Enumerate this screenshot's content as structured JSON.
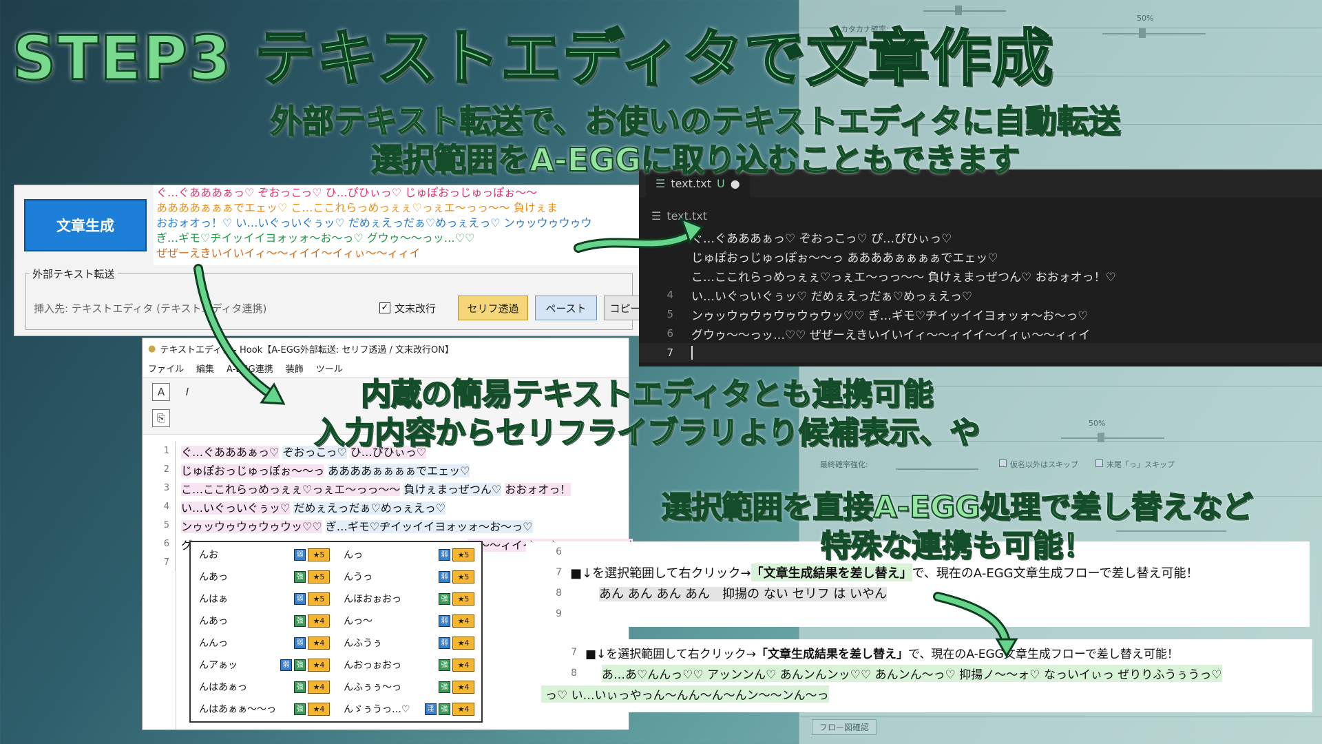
{
  "title": {
    "main": "STEP3 テキストエディタで文章作成"
  },
  "subtitles": {
    "s1_line1": "外部テキスト転送で、お使いのテキストエディタに自動転送",
    "s1_line2": "選択範囲をA-EGGに取り込むこともできます",
    "s2_line1": "内蔵の簡易テキストエディタとも連携可能",
    "s2_line2": "入力内容からセリフライブラリより候補表示、や",
    "s3_line1": "選択範囲を直接A-EGG処理で差し替えなど",
    "s3_line2": "特殊な連携も可能！"
  },
  "generator": {
    "button_label": "文章生成",
    "output_lines": [
      "ぐ…ぐあああぁっ♡ ぞおっこっ♡ ひ…ぴひぃっ♡ じゅぽおっじゅっぽぉ～～",
      "ああああぁぁぁでエェッ♡ こ…ここれらっめっぇぇ♡っぇエ～っっ～～ 負けぇま",
      "おおォオっ！♡ い…いぐっいぐぅッ♡ だめぇえっだぁ♡めっぇえっ♡ ンゥッウゥウゥウ",
      "ぎ…ギモ♡ヂイッイイヨォッォ～お～っ♡ グウゥ～～っッ…♡♡",
      "ぜぜーえきいイいイィ～～ィイイ～イィぃ～～ィィイ"
    ],
    "group_title": "外部テキスト転送",
    "insert_target": "挿入先: テキストエディタ (テキストエディタ連携)",
    "checkbox_label": "文末改行",
    "checkbox_mark": "✓",
    "btn_serif": "セリフ透過",
    "btn_paste": "ペースト",
    "btn_copy": "コピー"
  },
  "vscode": {
    "tab_name": "text.txt",
    "tab_status": "U",
    "breadcrumb": "text.txt",
    "lines": [
      {
        "n": "",
        "t": "ぐ…ぐあああぁっ♡ ぞおっこっ♡ ぴ…ぴひぃっ♡"
      },
      {
        "n": "",
        "t": "じゅぽおっじゅっぽぉ～～っ ああああぁぁぁぁでエェッ♡"
      },
      {
        "n": "",
        "t": "こ…ここれらっめっぇぇ♡っぇエ～っっ～～ 負けぇまっぜつん♡ おおォオっ！♡"
      },
      {
        "n": "4",
        "t": "い…いぐっいぐぅッ♡ だめぇえっだぁ♡めっぇえっ♡"
      },
      {
        "n": "5",
        "t": "ンゥッウゥウゥウゥウゥウッ♡♡ ぎ…ギモ♡ヂイッイイヨォッォ～お～っ♡"
      },
      {
        "n": "6",
        "t": "グウゥ～～っッ…♡♡ ぜぜーえきいイいイィ～～ィイイ～イィぃ～～ィィイ"
      },
      {
        "n": "7",
        "t": ""
      }
    ]
  },
  "editor": {
    "title": "テキストエディタ - Hook【A-EGG外部転送: セリフ透過 / 文末改行ON】",
    "menu": [
      "ファイル",
      "編集",
      "A-EGG連携",
      "装飾",
      "ツール"
    ],
    "lines": [
      {
        "n": "1",
        "a": "ぐ…ぐあああぁっ♡",
        "b": "ぞおっこっ♡",
        "c": "ひ…ぴひぃっ♡"
      },
      {
        "n": "2",
        "a": "じゅぽおっじゅっぽぉ～～っ",
        "b": "ああああぁぁぁぁでエェッ♡",
        "c": ""
      },
      {
        "n": "3",
        "a": "こ…ここれらっめっぇぇ♡っぇエ～っっ～～",
        "b": "負けぇまっぜつん♡",
        "c": "おおォオっ！"
      },
      {
        "n": "4",
        "a": "い…いぐっいぐぅッ♡",
        "b": "だめぇえっだぁ♡めっぇえっ♡",
        "c": ""
      },
      {
        "n": "5",
        "a": "ンゥッウゥウゥウゥウッ♡♡",
        "b": "ぎ…ギモ♡ヂイッイイヨォッォ～お～っ♡",
        "c": ""
      },
      {
        "n": "6",
        "a": "グ",
        "b": "ィ～～ィイイ～イィぃ～～ィィイ",
        "c": ""
      },
      {
        "n": "7",
        "a": "",
        "b": "",
        "c": ""
      }
    ]
  },
  "autocomplete": {
    "rows": [
      {
        "l": "んお",
        "lb": [
          "弱"
        ],
        "ls": "★5",
        "r": "んっ",
        "rb": [
          "弱"
        ],
        "rs": "★5"
      },
      {
        "l": "んあっ",
        "lb": [
          "強"
        ],
        "ls": "★5",
        "r": "んうっ",
        "rb": [
          "弱"
        ],
        "rs": "★5"
      },
      {
        "l": "んはぁ",
        "lb": [
          "弱"
        ],
        "ls": "★5",
        "r": "んほおぉおっ",
        "rb": [
          "強"
        ],
        "rs": "★5"
      },
      {
        "l": "んあっ",
        "lb": [
          "強"
        ],
        "ls": "★4",
        "r": "んっ～",
        "rb": [
          "弱"
        ],
        "rs": "★4"
      },
      {
        "l": "んんっ",
        "lb": [
          "弱"
        ],
        "ls": "★4",
        "r": "んふうぅ",
        "rb": [
          "弱"
        ],
        "rs": "★4"
      },
      {
        "l": "んアぁッ",
        "lb": [
          "弱",
          "強"
        ],
        "ls": "★4",
        "r": "んおっぉおっ",
        "rb": [
          "強"
        ],
        "rs": "★4"
      },
      {
        "l": "んはあぁっ",
        "lb": [
          "強"
        ],
        "ls": "★4",
        "r": "んふぅぅ～っ",
        "rb": [
          "強"
        ],
        "rs": "★4"
      },
      {
        "l": "んはあぁぁ～～っ",
        "lb": [
          "強"
        ],
        "ls": "★4",
        "r": "んゞぅうっ…♡",
        "rb": [
          "淫",
          "強"
        ],
        "rs": "★4"
      }
    ]
  },
  "example1": {
    "lines": [
      {
        "n": "6",
        "t": ""
      },
      {
        "n": "7",
        "pre": "■↓を選択範囲して右クリック→",
        "bold": "「文章生成結果を差し替え」",
        "post": "で、現在のA-EGG文章生成フローで差し替え可能！"
      },
      {
        "n": "8",
        "t": "あん あん あん あん　抑揚の ない セリフ は いやん"
      },
      {
        "n": "9",
        "t": ""
      }
    ]
  },
  "example2": {
    "lines": [
      {
        "n": "7",
        "pre": "■↓を選択範囲して右クリック→",
        "bold": "「文章生成結果を差し替え」",
        "post": "で、現在のA-EGG文章生成フローで差し替え可能！"
      },
      {
        "n": "8",
        "t": "あ…あ♡んんっ♡♡ アッンンん♡ あんンんンッ♡♡ あんンん～っ♡ 抑揚ノ～～ォ♡ なっいイぃっ ぜりりふうぅうっ♡"
      },
      {
        "n": "",
        "t": "っ♡ い…いぃっやっん～んん～ん～んン～～ンん～っ"
      }
    ]
  },
  "background_panel": {
    "labels": [
      "カタカナ確率:",
      "50%",
      "50%",
      "最終確率強化:",
      "仮名以外はスキップ",
      "末尾「っ」スキップ",
      "フロー図確認"
    ]
  },
  "colors": {
    "title_fill": "#79d98e",
    "title_stroke": "#0d4222",
    "gen_button": "#1e7fd8",
    "serif_button": "#f5d77a",
    "paste_button": "#d5e5f6",
    "arrow": "#3fae67",
    "vscode_bg": "#1e1e1e"
  }
}
